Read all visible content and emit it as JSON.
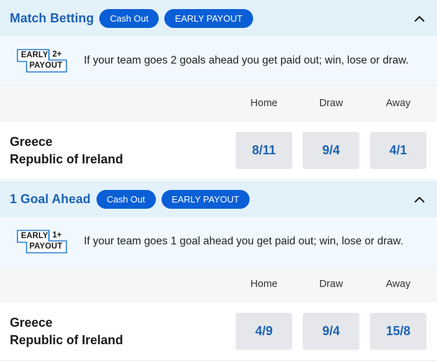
{
  "markets": [
    {
      "title": "Match Betting",
      "badges": [
        "Cash Out",
        "EARLY PAYOUT"
      ],
      "promo_badge": {
        "early": "EARLY",
        "num": "2+",
        "payout": "PAYOUT"
      },
      "promo_text": "If your team goes 2 goals ahead you get paid out; win, lose or draw.",
      "columns": [
        "Home",
        "Draw",
        "Away"
      ],
      "event": {
        "home_team": "Greece",
        "away_team": "Republic of Ireland"
      },
      "odds": [
        "8/11",
        "9/4",
        "4/1"
      ]
    },
    {
      "title": "1 Goal Ahead",
      "badges": [
        "Cash Out",
        "EARLY PAYOUT"
      ],
      "promo_badge": {
        "early": "EARLY",
        "num": "1+",
        "payout": "PAYOUT"
      },
      "promo_text": "If your team goes 1 goal ahead you get paid out; win, lose or draw.",
      "columns": [
        "Home",
        "Draw",
        "Away"
      ],
      "event": {
        "home_team": "Greece",
        "away_team": "Republic of Ireland"
      },
      "odds": [
        "4/9",
        "9/4",
        "15/8"
      ]
    }
  ],
  "icons": {
    "collapse": "chevron-up-icon"
  },
  "colors": {
    "header_bg": "#e3f1fb",
    "title": "#1a63b5",
    "pill": "#0a5fd6",
    "odds_bg": "#e5e7ea"
  }
}
